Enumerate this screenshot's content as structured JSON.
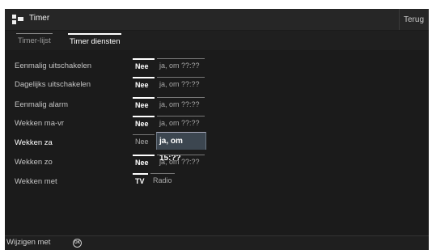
{
  "header": {
    "title": "Timer",
    "back_label": "Terug"
  },
  "tabs": [
    {
      "label": "Timer-lijst",
      "active": false
    },
    {
      "label": "Timer diensten",
      "active": true
    }
  ],
  "rows": [
    {
      "label": "Eenmalig uitschakelen",
      "left": "Nee",
      "right": "ja, om ??:??"
    },
    {
      "label": "Dagelijks uitschakelen",
      "left": "Nee",
      "right": "ja, om ??:??"
    },
    {
      "label": "Eenmalig alarm",
      "left": "Nee",
      "right": "ja, om ??:??"
    },
    {
      "label": "Wekken ma-vr",
      "left": "Nee",
      "right": "ja, om ??:??"
    },
    {
      "label": "Wekken za",
      "left": "Nee",
      "right": "ja, om 15:??"
    },
    {
      "label": "Wekken zo",
      "left": "Nee",
      "right": "ja, om ??:??"
    },
    {
      "label": "Wekken met",
      "left": "TV",
      "right": "Radio"
    }
  ],
  "footer": {
    "text": "Wijzigen met",
    "ok_icon": "ok-icon",
    "ok_label": "OK"
  },
  "colors": {
    "background": "#1b1b1b",
    "focus": "#3c4650"
  }
}
